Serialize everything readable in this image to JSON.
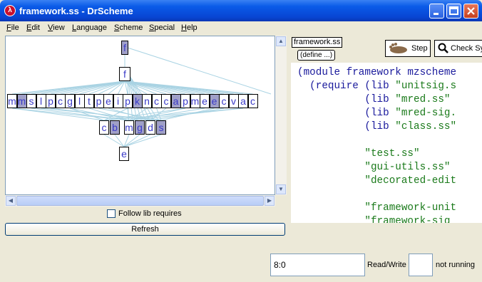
{
  "window": {
    "title": "framework.ss - DrScheme"
  },
  "menubar": [
    {
      "key": "F",
      "rest": "ile"
    },
    {
      "key": "E",
      "rest": "dit"
    },
    {
      "key": "V",
      "rest": "iew"
    },
    {
      "key": "L",
      "rest": "anguage"
    },
    {
      "key": "S",
      "rest": "cheme"
    },
    {
      "key": "S",
      "rest": "pecial"
    },
    {
      "key": "H",
      "rest": "elp"
    }
  ],
  "graph": {
    "top_node": "f",
    "second_node": "f",
    "row_nodes": [
      "m",
      "m",
      "s",
      "l",
      "p",
      "c",
      "g",
      "l",
      "t",
      "p",
      "e",
      "i",
      "p",
      "k",
      "n",
      "c",
      "c",
      "a",
      "p",
      "m",
      "e",
      "e",
      "c",
      "v",
      "a",
      "c"
    ],
    "lower_nodes": [
      "c",
      "b",
      "m",
      "g",
      "d",
      "s"
    ],
    "bottom_node": "e"
  },
  "left_panel": {
    "follow_lib_label": "Follow lib requires",
    "follow_lib_checked": false,
    "refresh_label": "Refresh"
  },
  "editor_panel": {
    "file_tab": "framework.ss",
    "define_button": "(define ...)",
    "step_label": "Step",
    "check_label": "Check Sy",
    "code_lines": [
      "(module framework mzscheme",
      "  (require (lib \"unitsig.s",
      "           (lib \"mred.ss\"",
      "           (lib \"mred-sig.",
      "           (lib \"class.ss\"",
      "",
      "           \"test.ss\"",
      "           \"gui-utils.ss\"",
      "           \"decorated-edit",
      "",
      "           \"framework-unit",
      "           \"framework-sig"
    ]
  },
  "statusbar": {
    "position": "8:0",
    "mode": "Read/Write",
    "running": "not running"
  }
}
